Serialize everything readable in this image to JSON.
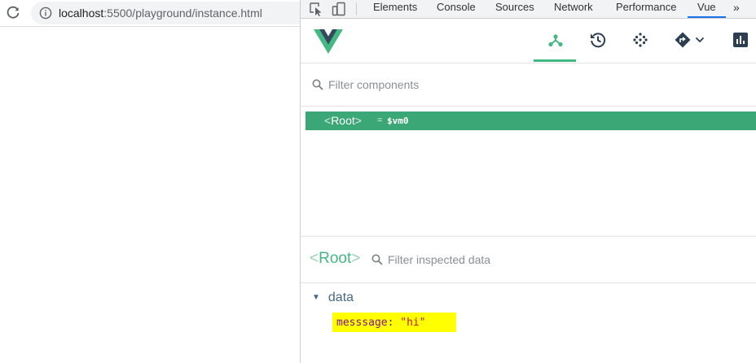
{
  "browser": {
    "url_host": "localhost",
    "url_path": ":5500/playground/instance.html"
  },
  "devtools": {
    "tabs": [
      {
        "label": "Elements",
        "active": false
      },
      {
        "label": "Console",
        "active": false
      },
      {
        "label": "Sources",
        "active": false
      },
      {
        "label": "Network",
        "active": false
      },
      {
        "label": "Performance",
        "active": false
      },
      {
        "label": "Vue",
        "active": true
      }
    ],
    "more_glyph": "»"
  },
  "vue": {
    "toolbar_icons": [
      "components-icon",
      "history-icon",
      "vuex-icon",
      "router-icon",
      "chevron-down-icon",
      "performance-icon"
    ],
    "accent": "#42b983",
    "filter_components_placeholder": "Filter components",
    "tree": [
      {
        "open_bracket": "<",
        "name": "Root",
        "close_bracket": ">",
        "eq": "=",
        "ref": "$vm0",
        "selected": true
      }
    ],
    "inspector": {
      "open_bracket": "<",
      "title": "Root",
      "close_bracket": ">",
      "filter_placeholder": "Filter inspected data",
      "section": {
        "label": "data",
        "items": [
          {
            "key": "messsage",
            "sep": ": ",
            "value": "\"hi\"",
            "highlight": "#ffff00"
          }
        ]
      }
    }
  }
}
